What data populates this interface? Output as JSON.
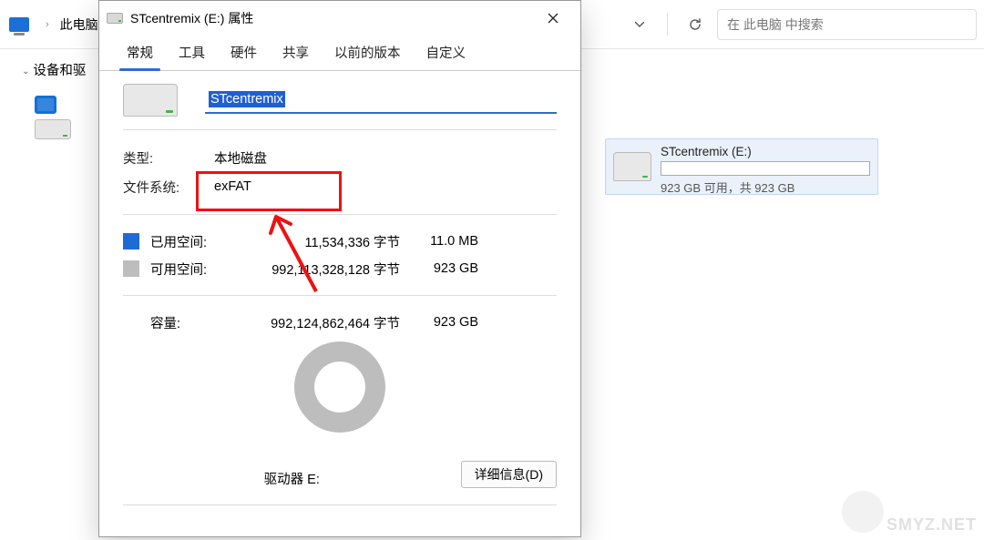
{
  "toolbar": {
    "breadcrumb_root": "此电脑",
    "search_placeholder": "在 此电脑 中搜索"
  },
  "sidebar": {
    "tree_label": "设备和驱"
  },
  "drive_card": {
    "title": "STcentremix (E:)",
    "subtext": "923 GB 可用，共 923 GB"
  },
  "dialog": {
    "title": "STcentremix (E:) 属性",
    "tabs": [
      "常规",
      "工具",
      "硬件",
      "共享",
      "以前的版本",
      "自定义"
    ],
    "active_tab": 0,
    "name_value": "STcentremix",
    "type_label": "类型:",
    "type_value": "本地磁盘",
    "fs_label": "文件系统:",
    "fs_value": "exFAT",
    "used_label": "已用空间:",
    "used_bytes": "11,534,336 字节",
    "used_human": "11.0 MB",
    "free_label": "可用空间:",
    "free_bytes": "992,113,328,128 字节",
    "free_human": "923 GB",
    "cap_label": "容量:",
    "cap_bytes": "992,124,862,464 字节",
    "cap_human": "923 GB",
    "drive_letter_label": "驱动器 E:",
    "details_btn": "详细信息(D)"
  },
  "watermark": "SMYZ.NET"
}
